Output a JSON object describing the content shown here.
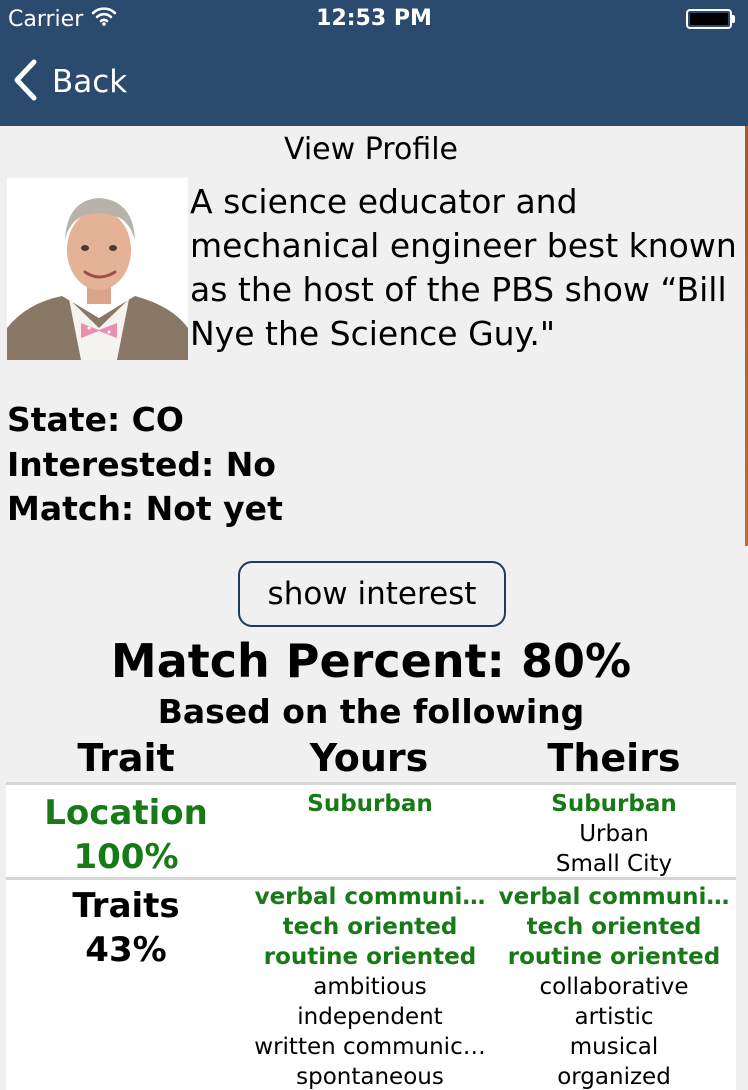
{
  "status_bar": {
    "carrier": "Carrier",
    "time": "12:53 PM"
  },
  "nav": {
    "back_label": "Back"
  },
  "page": {
    "title": "View Profile"
  },
  "profile": {
    "bio": "A science educator and mechanical engineer best known as the host of the PBS show “Bill Nye the Science Guy.\"",
    "state": "State: CO",
    "interested": "Interested: No",
    "match": "Match: Not yet"
  },
  "actions": {
    "show_interest_label": "show interest"
  },
  "match": {
    "percent_text": "Match Percent: 80%",
    "subtitle": "Based on the following",
    "headers": {
      "trait": "Trait",
      "yours": "Yours",
      "theirs": "Theirs"
    },
    "rows": [
      {
        "label_line1": "Location",
        "label_line2": "100%",
        "yours": [
          {
            "text": "Suburban",
            "matched": true
          }
        ],
        "theirs": [
          {
            "text": "Suburban",
            "matched": true
          },
          {
            "text": "Urban",
            "matched": false
          },
          {
            "text": "Small City",
            "matched": false
          }
        ]
      },
      {
        "label_line1": "Traits",
        "label_line2": "43%",
        "yours": [
          {
            "text": "verbal communi…",
            "matched": true
          },
          {
            "text": "tech oriented",
            "matched": true
          },
          {
            "text": "routine oriented",
            "matched": true
          },
          {
            "text": "ambitious",
            "matched": false
          },
          {
            "text": "independent",
            "matched": false
          },
          {
            "text": "written communic…",
            "matched": false
          },
          {
            "text": "spontaneous",
            "matched": false
          }
        ],
        "theirs": [
          {
            "text": "verbal communi…",
            "matched": true
          },
          {
            "text": "tech oriented",
            "matched": true
          },
          {
            "text": "routine oriented",
            "matched": true
          },
          {
            "text": "collaborative",
            "matched": false
          },
          {
            "text": "artistic",
            "matched": false
          },
          {
            "text": "musical",
            "matched": false
          },
          {
            "text": "organized",
            "matched": false
          }
        ]
      }
    ]
  },
  "colors": {
    "nav_bar": "#2a4a6e",
    "match_green": "#177a17",
    "background": "#f0f0f0"
  },
  "icons": [
    "wifi-icon",
    "battery-icon",
    "chevron-left-icon"
  ]
}
